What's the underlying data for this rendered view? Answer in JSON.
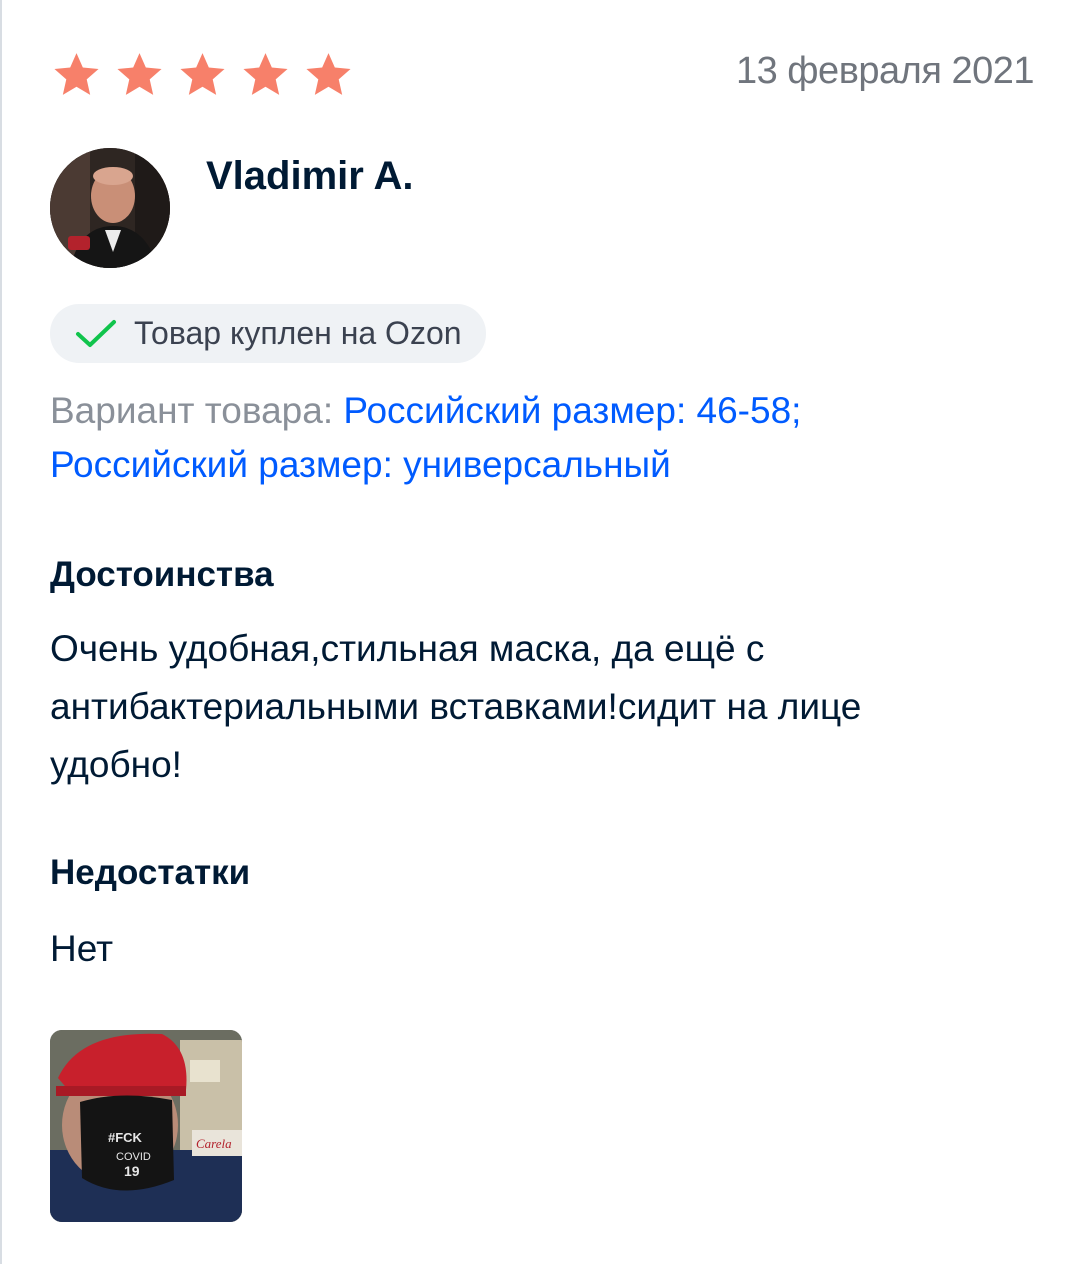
{
  "review": {
    "rating": 5,
    "rating_max": 5,
    "date": "13 февраля 2021",
    "author": "Vladimir A.",
    "purchase_badge": "Товар куплен на Ozon",
    "variant_label": "Вариант товара: ",
    "variant_value_line1": "Российский размер: 46-58;",
    "variant_value_line2": "Российский размер: универсальный",
    "pros_title": "Достоинства",
    "pros_text": "Очень удобная,стильная маска, да ещё с антибактериальными вставками!сидит на лице удобно!",
    "cons_title": "Недостатки",
    "cons_text": "Нет"
  },
  "colors": {
    "star": "#f7806a",
    "link": "#005bff",
    "check": "#10c44c",
    "badge_bg": "#eff2f5",
    "text": "#001a34",
    "muted": "#70757d"
  },
  "icons": {
    "star": "star-icon",
    "check": "checkmark-icon"
  }
}
